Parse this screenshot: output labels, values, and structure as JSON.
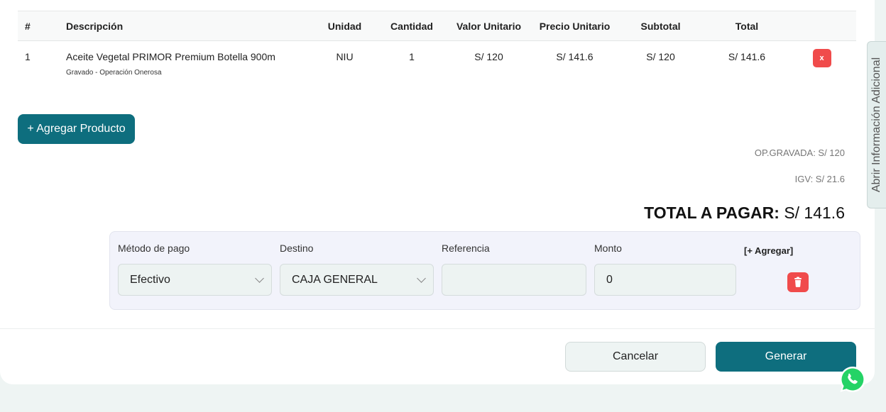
{
  "table": {
    "headers": {
      "num": "#",
      "desc": "Descripción",
      "unit": "Unidad",
      "qty": "Cantidad",
      "unit_value": "Valor Unitario",
      "unit_price": "Precio Unitario",
      "subtotal": "Subtotal",
      "total": "Total"
    },
    "rows": [
      {
        "num": "1",
        "desc": "Aceite Vegetal PRIMOR Premium Botella 900m",
        "desc_sub": "Gravado - Operación Onerosa",
        "unit": "NIU",
        "qty": "1",
        "unit_value": "S/ 120",
        "unit_price": "S/ 141.6",
        "subtotal": "S/ 120",
        "total": "S/ 141.6",
        "remove_label": "x"
      }
    ]
  },
  "add_product_label": "+ Agregar Producto",
  "summary": {
    "op_gravada": "OP.GRAVADA: S/ 120",
    "igv": "IGV: S/ 21.6",
    "total_label": "TOTAL A PAGAR:",
    "total_value": "S/ 141.6"
  },
  "payment": {
    "method_label": "Método de pago",
    "method_value": "Efectivo",
    "dest_label": "Destino",
    "dest_value": "CAJA GENERAL",
    "ref_label": "Referencia",
    "ref_value": "",
    "amount_label": "Monto",
    "amount_value": "0",
    "add_label": "[+ Agregar]"
  },
  "footer": {
    "cancel_label": "Cancelar",
    "generate_label": "Generar"
  },
  "side_tab_label": "Abrir Información Adicional",
  "colors": {
    "primary": "#0e6e7e",
    "danger": "#f04b4b",
    "whatsapp": "#25d366"
  }
}
